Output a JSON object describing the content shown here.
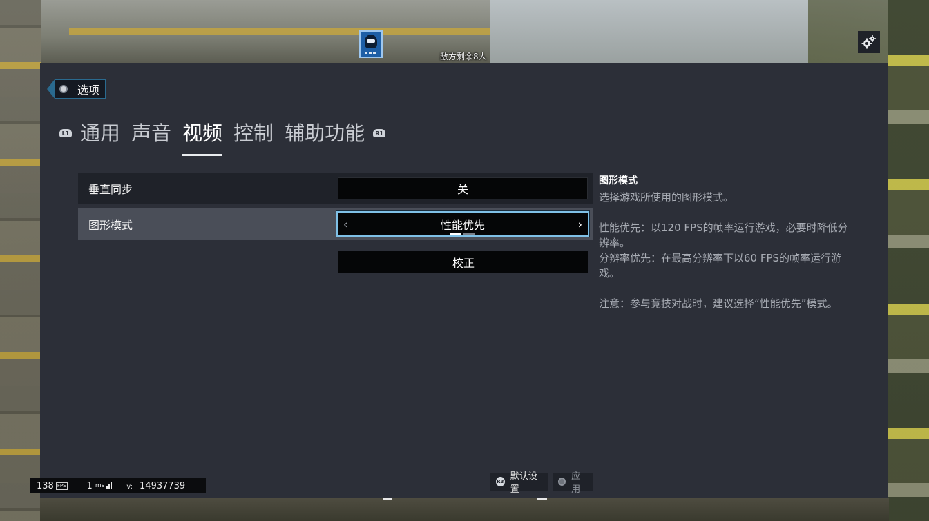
{
  "hud": {
    "enemies_remaining": "敌方剩余8人",
    "fps_value": "138",
    "fps_tag": "FPS",
    "ping_value": "1",
    "ping_unit": "ms",
    "version_label": "v:",
    "version_value": "14937739"
  },
  "options": {
    "title": "选项",
    "left_bumper": "L1",
    "right_bumper": "R1",
    "tabs": [
      {
        "label": "通用",
        "active": false
      },
      {
        "label": "声音",
        "active": false
      },
      {
        "label": "视频",
        "active": true
      },
      {
        "label": "控制",
        "active": false
      },
      {
        "label": "辅助功能",
        "active": false
      }
    ],
    "settings": {
      "vsync": {
        "label": "垂直同步",
        "value": "关"
      },
      "graphics_mode": {
        "label": "图形模式",
        "value": "性能优先",
        "pages": 2,
        "current_page": 1
      },
      "calibrate_label": "校正"
    },
    "description": {
      "heading": "图形模式",
      "summary": "选择游戏所使用的图形模式。",
      "performance": "性能优先：以120 FPS的帧率运行游戏，必要时降低分辨率。",
      "resolution": "分辨率优先：在最高分辨率下以60 FPS的帧率运行游戏。",
      "note": "注意：参与竞技对战时，建议选择“性能优先”模式。"
    },
    "footer": {
      "default_glyph": "R3",
      "default_label": "默认设置",
      "apply_label": "应用"
    }
  },
  "colors": {
    "panel": "#2c2f38",
    "row_dark": "#1f2229",
    "row_selected": "#4a4e58",
    "focus_border": "#7fc0e6",
    "operator_card": "#1e5fa6"
  },
  "icons": [
    "gear-icon",
    "operator-icon",
    "title-circle-icon",
    "chevron-left-icon",
    "chevron-right-icon",
    "signal-icon",
    "r3-button-icon",
    "options-button-icon"
  ]
}
